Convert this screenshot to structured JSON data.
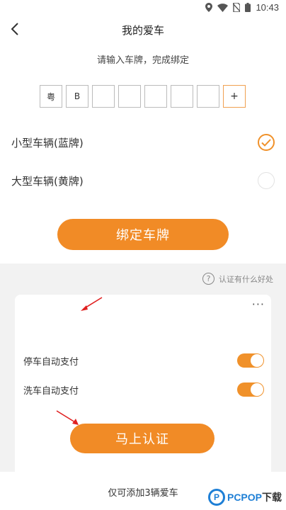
{
  "status_bar": {
    "time": "10:43",
    "icons": [
      "location-icon",
      "wifi-icon",
      "no-sim-icon",
      "battery-icon"
    ]
  },
  "header": {
    "title": "我的爱车",
    "back_icon": "chevron-left-icon"
  },
  "plate_input": {
    "hint": "请输入车牌，完成绑定",
    "chars": [
      "粤",
      "B",
      "",
      "",
      "",
      "",
      ""
    ],
    "add_label": "+"
  },
  "vehicle_types": [
    {
      "label": "小型车辆(蓝牌)",
      "selected": true
    },
    {
      "label": "大型车辆(黄牌)",
      "selected": false
    }
  ],
  "bind_button": {
    "label": "绑定车牌"
  },
  "benefits_link": {
    "label": "认证有什么好处",
    "icon": "help-circle-icon"
  },
  "card": {
    "more_label": "···",
    "toggles": [
      {
        "label": "停车自动支付",
        "on": true
      },
      {
        "label": "洗车自动支付",
        "on": true
      }
    ],
    "verify_button": {
      "label": "马上认证"
    }
  },
  "footer": {
    "text": "仅可添加3辆爱车"
  },
  "watermark": {
    "text_latin": "PCPOP",
    "text_cn": "下载",
    "logo": "P"
  },
  "colors": {
    "accent": "#f18b26",
    "background_gray": "#f2f2f2",
    "arrow_red": "#e02020"
  }
}
